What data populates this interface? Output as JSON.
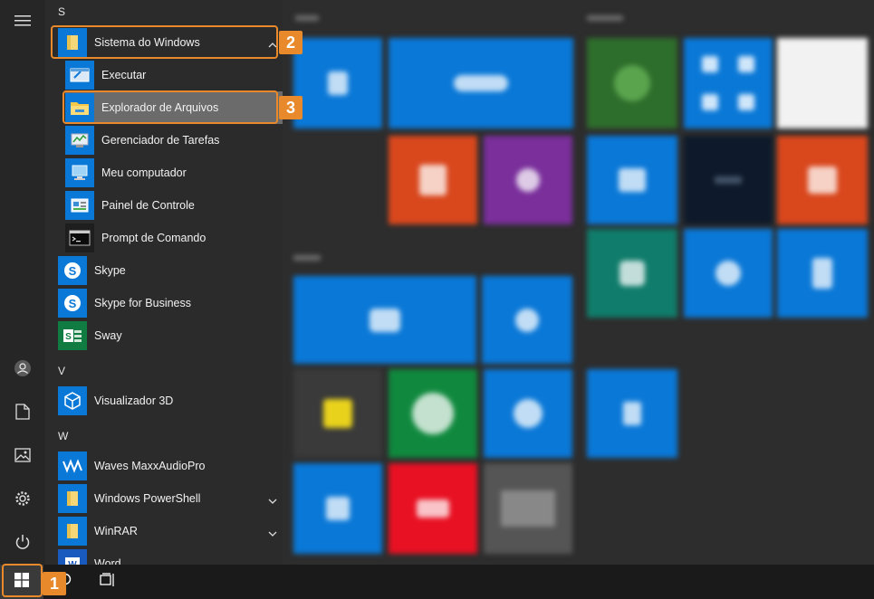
{
  "app_list": {
    "groups": {
      "s": "S",
      "v": "V",
      "w": "W"
    },
    "items": [
      {
        "label": "Sistema do Windows"
      },
      {
        "label": "Executar"
      },
      {
        "label": "Explorador de Arquivos"
      },
      {
        "label": "Gerenciador de Tarefas"
      },
      {
        "label": "Meu computador"
      },
      {
        "label": "Painel de Controle"
      },
      {
        "label": "Prompt de Comando"
      },
      {
        "label": "Skype"
      },
      {
        "label": "Skype for Business"
      },
      {
        "label": "Sway"
      },
      {
        "label": "Visualizador 3D"
      },
      {
        "label": "Waves MaxxAudioPro"
      },
      {
        "label": "Windows PowerShell"
      },
      {
        "label": "WinRAR"
      },
      {
        "label": "Word"
      }
    ]
  },
  "callouts": {
    "step1": "1",
    "step2": "2",
    "step3": "3"
  },
  "colors": {
    "accent": "#e8892b",
    "tile_blue": "#0a78d7",
    "rail": "#262626",
    "list_bg": "#2b2b2b",
    "taskbar": "#1a1a1a"
  },
  "icons": {
    "rail": [
      "hamburger-menu-icon",
      "user-account-icon",
      "documents-icon",
      "pictures-icon",
      "settings-gear-icon",
      "power-icon"
    ],
    "taskbar": [
      "windows-start-icon",
      "search-icon",
      "task-view-icon"
    ]
  }
}
